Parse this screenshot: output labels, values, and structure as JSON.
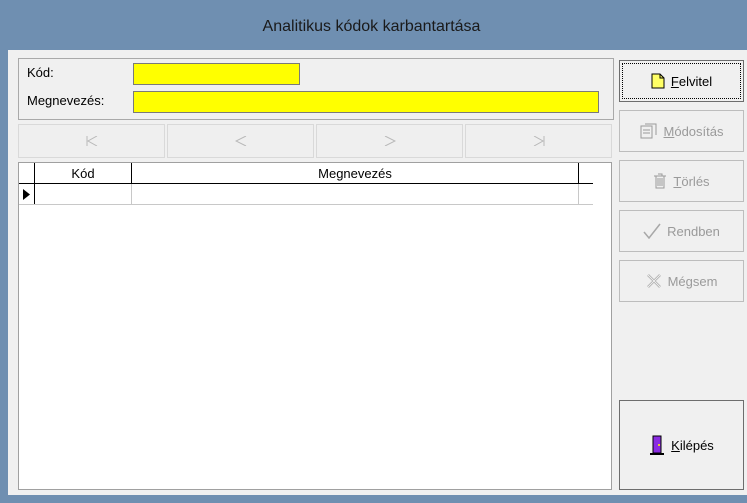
{
  "window": {
    "title": "Analitikus kódok karbantartása"
  },
  "form": {
    "kod_label": "Kód:",
    "kod_value": "",
    "megnevezes_label": "Megnevezés:",
    "megnevezes_value": ""
  },
  "navigator": {
    "buttons": [
      "first",
      "prior",
      "next",
      "last"
    ]
  },
  "grid": {
    "columns": [
      "Kód",
      "Megnevezés"
    ],
    "rows": [
      {
        "kod": "",
        "megnevezes": ""
      }
    ]
  },
  "actions": {
    "felvitel": {
      "label": "Felvitel",
      "underline": "F",
      "rest": "elvitel",
      "enabled": true
    },
    "modositas": {
      "label": "Módosítás",
      "underline": "M",
      "rest": "ódosítás",
      "enabled": false
    },
    "torles": {
      "label": "Törlés",
      "underline": "T",
      "rest": "örlés",
      "enabled": false
    },
    "rendben": {
      "label": "Rendben",
      "enabled": false
    },
    "megsem": {
      "label": "Mégsem",
      "enabled": false
    },
    "kilepes": {
      "label": "Kilépés",
      "underline": "K",
      "rest": "ilépés",
      "enabled": true
    }
  },
  "colors": {
    "titlebar": "#6f8fb1",
    "input_bg": "#ffff00",
    "client": "#f0f0f0"
  }
}
